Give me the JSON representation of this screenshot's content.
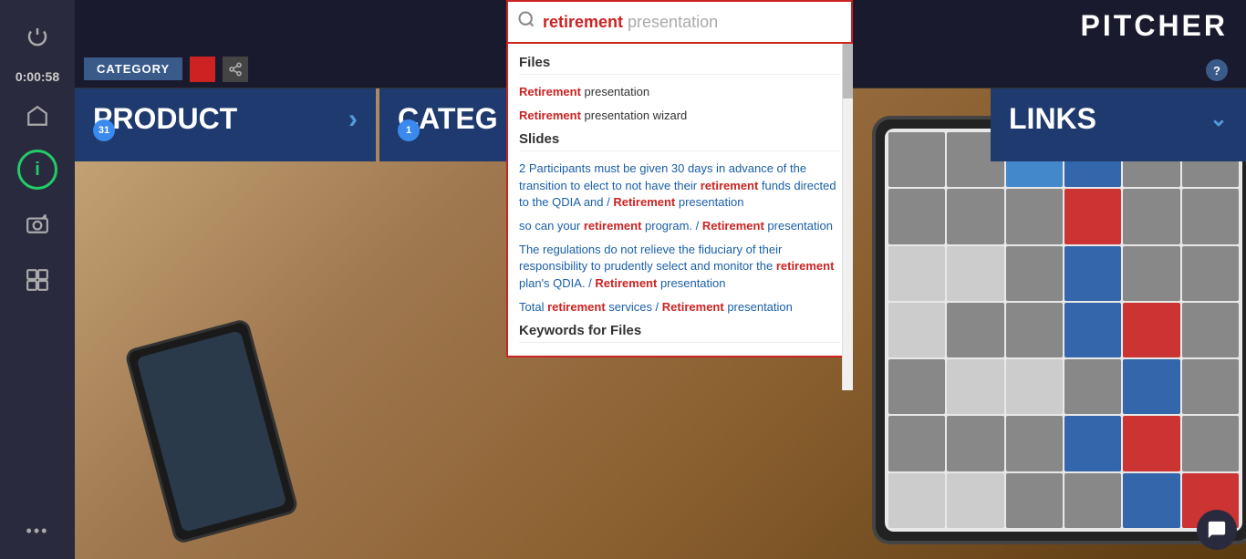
{
  "app": {
    "title": "PITCHER",
    "help_label": "?"
  },
  "sidebar": {
    "timer": "0:00:58",
    "icons": {
      "power": "⏻",
      "home": "⌂",
      "info": "i",
      "camera": "📷",
      "screens": "⧉",
      "dots": "•••"
    }
  },
  "catbar": {
    "label": "CATEGORY",
    "share_icon": "⤴"
  },
  "cards": [
    {
      "id": "product",
      "title": "PRODUCT",
      "badge": "31",
      "has_arrow": true
    },
    {
      "id": "category",
      "title": "CATEG",
      "badge": "1",
      "has_chevron": true
    },
    {
      "id": "links",
      "title": "LINKS",
      "has_chevron": true
    }
  ],
  "search": {
    "query_highlight": "retirement",
    "query_normal": " presentation",
    "search_icon": "🔍",
    "sections": [
      {
        "title": "Files",
        "items": [
          {
            "parts": [
              {
                "text": "Retirement",
                "style": "red"
              },
              {
                "text": " presentation",
                "style": "normal"
              }
            ]
          },
          {
            "parts": [
              {
                "text": "Retirement",
                "style": "red"
              },
              {
                "text": " presentation wizard",
                "style": "normal"
              }
            ]
          }
        ]
      },
      {
        "title": "Slides",
        "items": [
          {
            "parts": [
              {
                "text": "2 Participants must be given 30 days in advance of the transition to elect to not have their ",
                "style": "blue"
              },
              {
                "text": "retirement",
                "style": "red"
              },
              {
                "text": " funds directed to the QDIA and / ",
                "style": "blue"
              },
              {
                "text": "Retirement",
                "style": "red"
              },
              {
                "text": " presentation",
                "style": "blue"
              }
            ]
          },
          {
            "parts": [
              {
                "text": "so can your ",
                "style": "blue"
              },
              {
                "text": "retirement",
                "style": "red"
              },
              {
                "text": " program.  / ",
                "style": "blue"
              },
              {
                "text": "Retirement",
                "style": "red"
              },
              {
                "text": " presentation",
                "style": "blue"
              }
            ]
          },
          {
            "parts": [
              {
                "text": "The regulations do not relieve the fiduciary of their responsibility to prudently select and monitor the ",
                "style": "blue"
              },
              {
                "text": "retirement",
                "style": "red"
              },
              {
                "text": " plan's QDIA. / ",
                "style": "blue"
              },
              {
                "text": "Retirement",
                "style": "red"
              },
              {
                "text": " presentation",
                "style": "blue"
              }
            ]
          },
          {
            "parts": [
              {
                "text": "Total ",
                "style": "blue"
              },
              {
                "text": "retirement",
                "style": "red"
              },
              {
                "text": " services / ",
                "style": "blue"
              },
              {
                "text": "Retirement",
                "style": "red"
              },
              {
                "text": " presentation",
                "style": "blue"
              }
            ]
          }
        ]
      },
      {
        "title": "Keywords for Files",
        "items": []
      }
    ]
  },
  "chat_icon": "💬"
}
